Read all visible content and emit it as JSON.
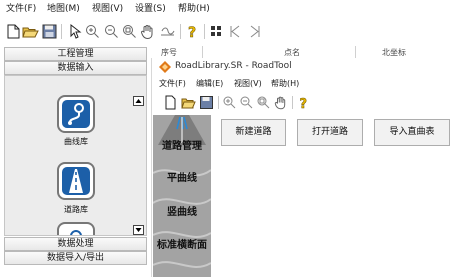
{
  "menubar": {
    "items": [
      "文件(F)",
      "地图(M)",
      "视图(V)",
      "设置(S)",
      "帮助(H)"
    ]
  },
  "toolbar": {
    "icons": [
      "new-file-icon",
      "open-folder-icon",
      "save-icon",
      "pointer-icon",
      "zoom-in-icon",
      "zoom-out-icon",
      "zoom-extent-icon",
      "pan-hand-icon",
      "measure-icon",
      "help-icon",
      "grid-icon",
      "back-icon",
      "forward-icon"
    ]
  },
  "left_panel": {
    "close_glyph": "×",
    "headers": {
      "project": "工程管理",
      "data_input": "数据输入",
      "data_process": "数据处理",
      "data_io": "数据导入/导出"
    },
    "items": [
      {
        "label": "曲线库",
        "icon": "curve-library-icon"
      },
      {
        "label": "道路库",
        "icon": "road-library-icon"
      }
    ]
  },
  "grid_header": {
    "columns": [
      "序号",
      "点名",
      "北坐标"
    ]
  },
  "child_window": {
    "title": "RoadLibrary.SR - RoadTool",
    "menu": [
      "文件(F)",
      "编辑(E)",
      "视图(V)",
      "帮助(H)"
    ],
    "sidebar": [
      "道路管理",
      "平曲线",
      "竖曲线",
      "标准横断面"
    ],
    "buttons": [
      "新建道路",
      "打开道路",
      "导入直曲表"
    ]
  },
  "colors": {
    "accent_blue": "#1c5fa8",
    "sidebar_gray": "#9a9a9a",
    "help_yellow": "#e8b800"
  }
}
